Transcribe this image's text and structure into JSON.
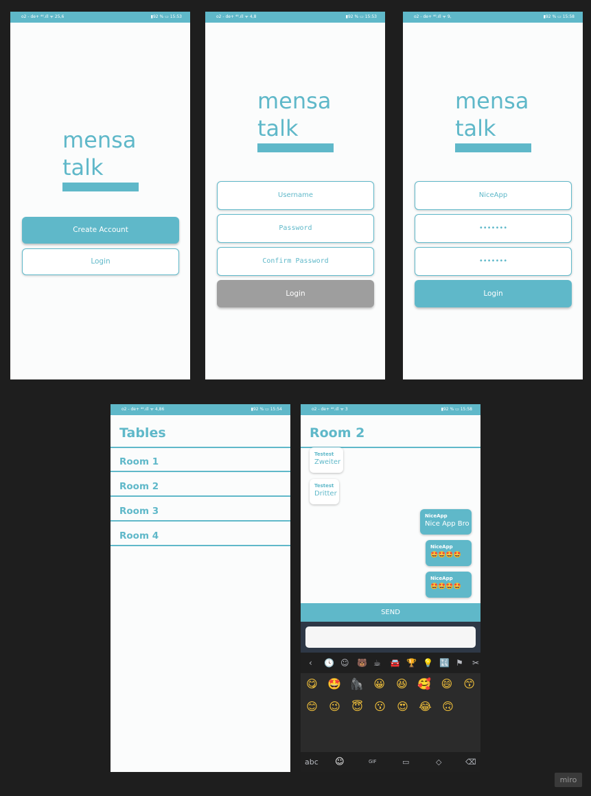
{
  "status_bars": {
    "s1": {
      "left": "o2 - de+ ⁴⁶.ıll ᯤ 25,6",
      "right": "▮92 % ▭ 15:53"
    },
    "s2": {
      "left": "o2 - de+ ⁴⁶.ıll ᯤ 4,8",
      "right": "▮92 % ▭ 15:53"
    },
    "s3": {
      "left": "o2 - de+ ⁴⁶.ıll ᯤ 9,",
      "right": "▮92 % ▭ 15:58"
    },
    "s4": {
      "left": "o2 - de+ ⁴⁶.ıll ᯤ 4,86",
      "right": "▮92 % ▭ 15:54"
    },
    "s5": {
      "left": "o2 - de+ ⁴⁶.ıll ᯤ 3",
      "right": "▮92 % ▭ 15:58"
    }
  },
  "logo": {
    "line1": "mensa",
    "line2": "talk"
  },
  "welcome": {
    "create_account": "Create Account",
    "login": "Login"
  },
  "register": {
    "username_placeholder": "Username",
    "password_placeholder": "Password",
    "confirm_placeholder": "Confirm Password",
    "login": "Login"
  },
  "register_filled": {
    "username": "NiceApp",
    "password": "•••••••",
    "confirm": "•••••••",
    "login": "Login"
  },
  "tables": {
    "title": "Tables",
    "rooms": [
      "Room 1",
      "Room 2",
      "Room 3",
      "Room 4"
    ]
  },
  "chat": {
    "title": "Room 2",
    "messages": [
      {
        "author": "Testest",
        "text": "Zweiter"
      },
      {
        "author": "Testest",
        "text": "Dritter"
      },
      {
        "author": "NiceApp",
        "text": "Nice App Bro"
      },
      {
        "author": "NiceApp",
        "text": "🤩🤩🤩🤩"
      },
      {
        "author": "NiceApp",
        "text": "🤩🤩🤩🤩"
      }
    ],
    "send": "SEND",
    "input_value": ""
  },
  "keyboard": {
    "category_icons": [
      "‹",
      "🕓",
      "☺",
      "🐻",
      "☕",
      "🚘",
      "🏆",
      "💡",
      "🔣",
      "⚑",
      "✂"
    ],
    "row1": [
      "😋",
      "🤩",
      "🦍",
      "😀",
      "😆",
      "🥰",
      "😄",
      "😙"
    ],
    "row2": [
      "😊",
      "😉",
      "😇",
      "😗",
      "😍",
      "😂",
      "🙃"
    ],
    "abc": "abc",
    "bottom_icons": [
      "☺",
      "GIF",
      "▭",
      "◇",
      "⌫"
    ]
  },
  "watermark": "miro",
  "colors": {
    "accent": "#5fb8c9",
    "disabled": "#9e9e9e",
    "keyboard_bg": "#2b2b2b"
  }
}
